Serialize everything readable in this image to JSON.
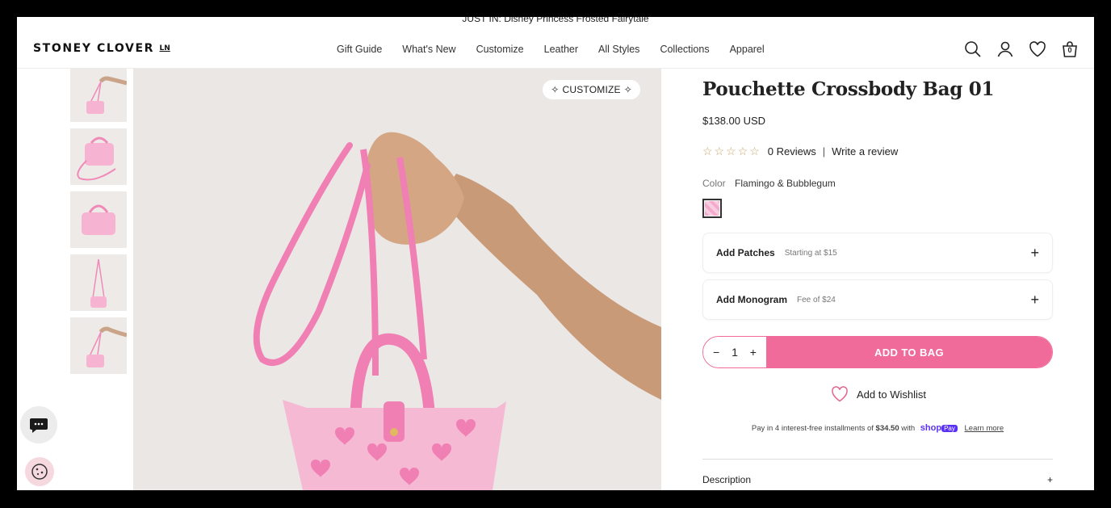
{
  "announcement": "JUST IN: Disney Princess Frosted Fairytale",
  "header": {
    "logo": "STONEY CLOVER",
    "logo_mark": "LN",
    "nav": [
      "Gift Guide",
      "What's New",
      "Customize",
      "Leather",
      "All Styles",
      "Collections",
      "Apparel"
    ],
    "cart_count": "0"
  },
  "gallery": {
    "customize_label": "CUSTOMIZE"
  },
  "product": {
    "title": "Pouchette Crossbody Bag 01",
    "price": "$138.00 USD",
    "reviews_label": "0 Reviews",
    "write_review": "Write a review",
    "rating": 0,
    "color_label": "Color",
    "color_value": "Flamingo & Bubblegum",
    "options": [
      {
        "title": "Add Patches",
        "subtitle": "Starting at $15"
      },
      {
        "title": "Add Monogram",
        "subtitle": "Fee of $24"
      }
    ],
    "quantity": "1",
    "add_to_bag": "ADD TO BAG",
    "wishlist": "Add to Wishlist",
    "installments_text": "Pay in 4 interest-free installments of",
    "installments_amount": "$34.50",
    "installments_with": "with",
    "shop_label": "shop",
    "pay_label": "Pay",
    "learn_more": "Learn more",
    "description_label": "Description"
  },
  "colors": {
    "accent": "#f06b99",
    "star": "#c9a66b",
    "shop_pay": "#5a31f4"
  }
}
